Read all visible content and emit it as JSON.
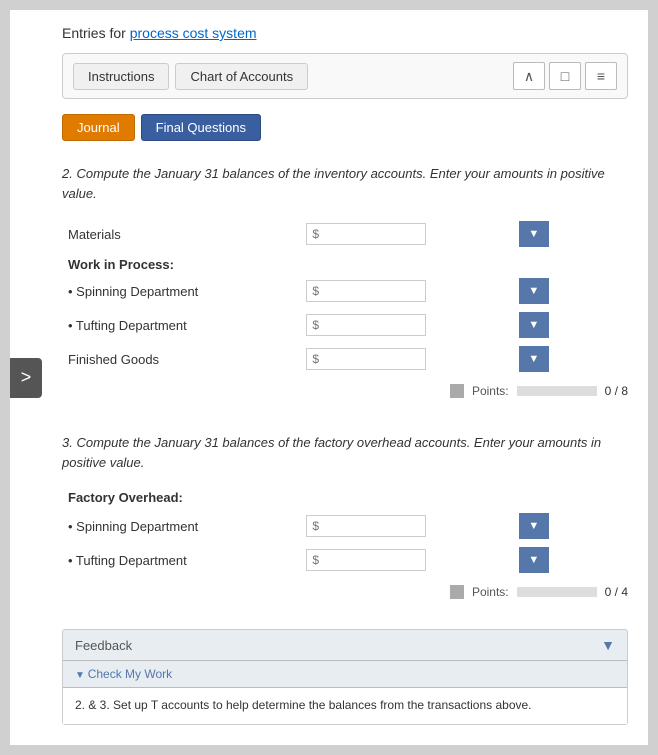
{
  "header": {
    "entries_label": "Entries for",
    "link_text": "process cost system"
  },
  "tabs": {
    "instructions_label": "Instructions",
    "chart_label": "Chart of Accounts",
    "journal_label": "Journal",
    "final_label": "Final Questions"
  },
  "controls": {
    "up_arrow": "∧",
    "window_icon": "□",
    "menu_icon": "≡"
  },
  "section2": {
    "instruction": "2. Compute the January 31 balances of the inventory accounts. Enter your amounts in positive value.",
    "materials_label": "Materials",
    "wip_label": "Work in Process:",
    "spinning_label": "• Spinning Department",
    "tufting_label": "• Tufting Department",
    "finished_label": "Finished Goods",
    "dollar_placeholder": "$",
    "points_label": "Points:",
    "points_score": "0 / 8"
  },
  "section3": {
    "instruction": "3. Compute the January 31 balances of the factory overhead accounts. Enter your amounts in positive value.",
    "factory_label": "Factory Overhead:",
    "spinning_label": "• Spinning Department",
    "tufting_label": "• Tufting Department",
    "dollar_placeholder": "$",
    "points_label": "Points:",
    "points_score": "0 / 4"
  },
  "feedback": {
    "title": "Feedback",
    "check_work": "Check My Work",
    "body_text": "2. & 3. Set up T accounts to help determine the balances from the transactions above."
  },
  "nav": {
    "arrow": ">"
  }
}
